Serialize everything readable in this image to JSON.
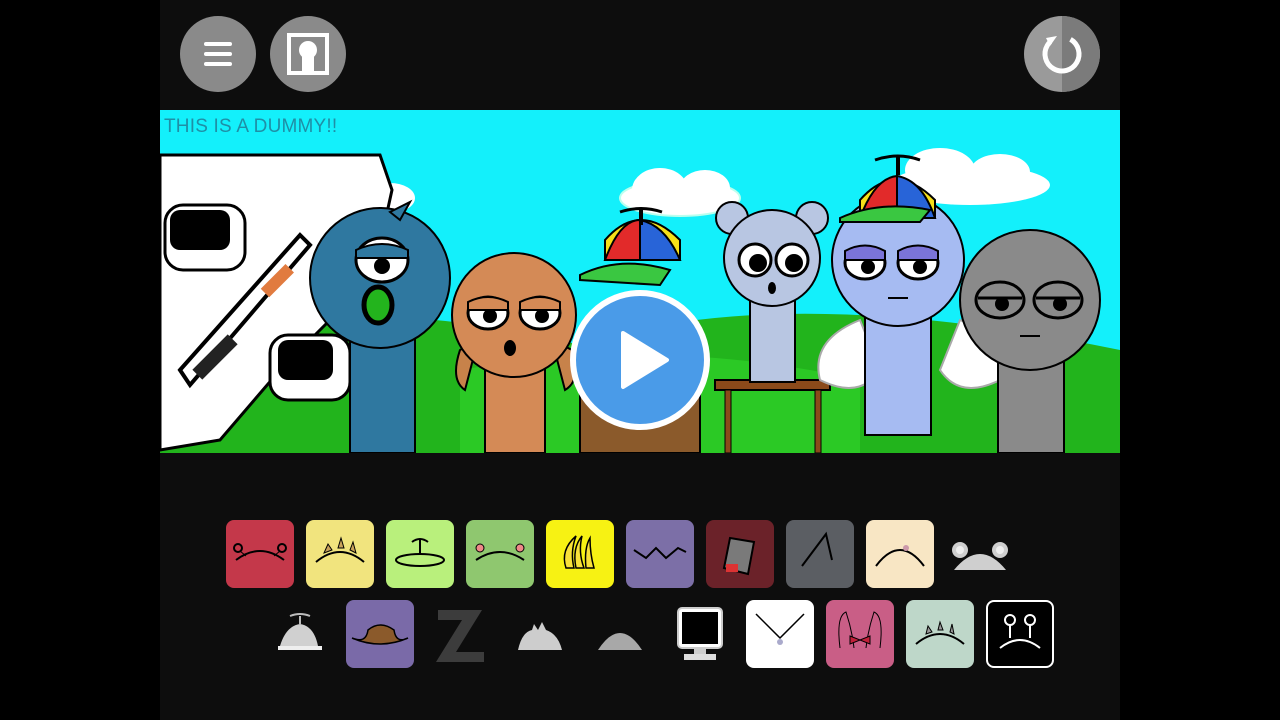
{
  "header": {
    "menu_icon": "hamburger-menu-icon",
    "gallery_icon": "character-gallery-icon",
    "reset_icon": "reset-circle-arrow-icon"
  },
  "scene": {
    "overlay_text": "THIS IS A DUMMY!!",
    "play_icon": "play-triangle-icon",
    "colors": {
      "sky": "#13f0fb",
      "grass": "#22b41c",
      "play": "#4a9be8"
    }
  },
  "palette": {
    "row1": [
      {
        "name": "red-antenna-tile",
        "color": "#c4384a"
      },
      {
        "name": "yellow-spikes-tile",
        "color": "#f1e47e"
      },
      {
        "name": "lime-propeller-tile",
        "color": "#b9f07c"
      },
      {
        "name": "green-antenna-tile",
        "color": "#8fc76f"
      },
      {
        "name": "banana-tile",
        "color": "#f7f213"
      },
      {
        "name": "purple-spikes-tile",
        "color": "#7c6fa7"
      },
      {
        "name": "bucket-hat-tile",
        "color": "#6b2229"
      },
      {
        "name": "gray-horn-tile",
        "color": "#5b5e63"
      },
      {
        "name": "cream-tile",
        "color": "#f8e6c4"
      },
      {
        "name": "mouse-ears-tile",
        "color": "#cfcfcf"
      }
    ],
    "row2": [
      {
        "name": "propeller-cap-tile",
        "color": "#d0d0d0"
      },
      {
        "name": "cowboy-hat-tile",
        "color": "#7a6aa8"
      },
      {
        "name": "sleep-z-tile",
        "color": "#3c3c3c"
      },
      {
        "name": "spiky-hair-tile",
        "color": "#cdcdcd"
      },
      {
        "name": "gray-dome-tile",
        "color": "#a8a8a8"
      },
      {
        "name": "computer-monitor-tile",
        "color": "#e0e0e0"
      },
      {
        "name": "white-collar-tile",
        "color": "#ffffff"
      },
      {
        "name": "pink-bowtie-tile",
        "color": "#c95e86"
      },
      {
        "name": "mint-spikes-tile",
        "color": "#bed7c9"
      },
      {
        "name": "black-antenna-tile",
        "color": "#000000"
      }
    ]
  }
}
